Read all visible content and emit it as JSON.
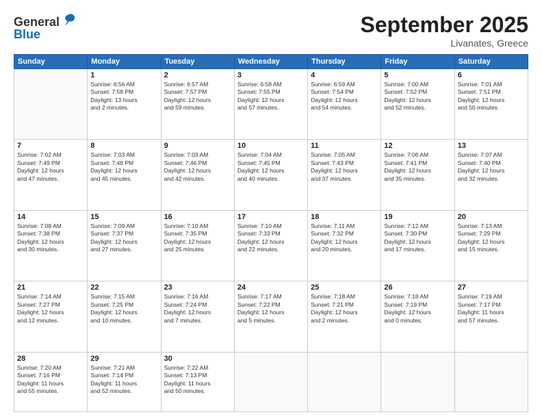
{
  "logo": {
    "general": "General",
    "blue": "Blue"
  },
  "title": "September 2025",
  "location": "Livanates, Greece",
  "days_header": [
    "Sunday",
    "Monday",
    "Tuesday",
    "Wednesday",
    "Thursday",
    "Friday",
    "Saturday"
  ],
  "weeks": [
    [
      {
        "day": "",
        "sunrise": "",
        "sunset": "",
        "daylight": "",
        "empty": true
      },
      {
        "day": "1",
        "sunrise": "Sunrise: 6:56 AM",
        "sunset": "Sunset: 7:58 PM",
        "daylight": "Daylight: 13 hours and 2 minutes."
      },
      {
        "day": "2",
        "sunrise": "Sunrise: 6:57 AM",
        "sunset": "Sunset: 7:57 PM",
        "daylight": "Daylight: 12 hours and 59 minutes."
      },
      {
        "day": "3",
        "sunrise": "Sunrise: 6:58 AM",
        "sunset": "Sunset: 7:55 PM",
        "daylight": "Daylight: 12 hours and 57 minutes."
      },
      {
        "day": "4",
        "sunrise": "Sunrise: 6:59 AM",
        "sunset": "Sunset: 7:54 PM",
        "daylight": "Daylight: 12 hours and 54 minutes."
      },
      {
        "day": "5",
        "sunrise": "Sunrise: 7:00 AM",
        "sunset": "Sunset: 7:52 PM",
        "daylight": "Daylight: 12 hours and 52 minutes."
      },
      {
        "day": "6",
        "sunrise": "Sunrise: 7:01 AM",
        "sunset": "Sunset: 7:51 PM",
        "daylight": "Daylight: 12 hours and 50 minutes."
      }
    ],
    [
      {
        "day": "7",
        "sunrise": "Sunrise: 7:02 AM",
        "sunset": "Sunset: 7:49 PM",
        "daylight": "Daylight: 12 hours and 47 minutes."
      },
      {
        "day": "8",
        "sunrise": "Sunrise: 7:03 AM",
        "sunset": "Sunset: 7:48 PM",
        "daylight": "Daylight: 12 hours and 45 minutes."
      },
      {
        "day": "9",
        "sunrise": "Sunrise: 7:03 AM",
        "sunset": "Sunset: 7:46 PM",
        "daylight": "Daylight: 12 hours and 42 minutes."
      },
      {
        "day": "10",
        "sunrise": "Sunrise: 7:04 AM",
        "sunset": "Sunset: 7:45 PM",
        "daylight": "Daylight: 12 hours and 40 minutes."
      },
      {
        "day": "11",
        "sunrise": "Sunrise: 7:05 AM",
        "sunset": "Sunset: 7:43 PM",
        "daylight": "Daylight: 12 hours and 37 minutes."
      },
      {
        "day": "12",
        "sunrise": "Sunrise: 7:06 AM",
        "sunset": "Sunset: 7:41 PM",
        "daylight": "Daylight: 12 hours and 35 minutes."
      },
      {
        "day": "13",
        "sunrise": "Sunrise: 7:07 AM",
        "sunset": "Sunset: 7:40 PM",
        "daylight": "Daylight: 12 hours and 32 minutes."
      }
    ],
    [
      {
        "day": "14",
        "sunrise": "Sunrise: 7:08 AM",
        "sunset": "Sunset: 7:38 PM",
        "daylight": "Daylight: 12 hours and 30 minutes."
      },
      {
        "day": "15",
        "sunrise": "Sunrise: 7:09 AM",
        "sunset": "Sunset: 7:37 PM",
        "daylight": "Daylight: 12 hours and 27 minutes."
      },
      {
        "day": "16",
        "sunrise": "Sunrise: 7:10 AM",
        "sunset": "Sunset: 7:35 PM",
        "daylight": "Daylight: 12 hours and 25 minutes."
      },
      {
        "day": "17",
        "sunrise": "Sunrise: 7:10 AM",
        "sunset": "Sunset: 7:33 PM",
        "daylight": "Daylight: 12 hours and 22 minutes."
      },
      {
        "day": "18",
        "sunrise": "Sunrise: 7:11 AM",
        "sunset": "Sunset: 7:32 PM",
        "daylight": "Daylight: 12 hours and 20 minutes."
      },
      {
        "day": "19",
        "sunrise": "Sunrise: 7:12 AM",
        "sunset": "Sunset: 7:30 PM",
        "daylight": "Daylight: 12 hours and 17 minutes."
      },
      {
        "day": "20",
        "sunrise": "Sunrise: 7:13 AM",
        "sunset": "Sunset: 7:29 PM",
        "daylight": "Daylight: 12 hours and 15 minutes."
      }
    ],
    [
      {
        "day": "21",
        "sunrise": "Sunrise: 7:14 AM",
        "sunset": "Sunset: 7:27 PM",
        "daylight": "Daylight: 12 hours and 12 minutes."
      },
      {
        "day": "22",
        "sunrise": "Sunrise: 7:15 AM",
        "sunset": "Sunset: 7:25 PM",
        "daylight": "Daylight: 12 hours and 10 minutes."
      },
      {
        "day": "23",
        "sunrise": "Sunrise: 7:16 AM",
        "sunset": "Sunset: 7:24 PM",
        "daylight": "Daylight: 12 hours and 7 minutes."
      },
      {
        "day": "24",
        "sunrise": "Sunrise: 7:17 AM",
        "sunset": "Sunset: 7:22 PM",
        "daylight": "Daylight: 12 hours and 5 minutes."
      },
      {
        "day": "25",
        "sunrise": "Sunrise: 7:18 AM",
        "sunset": "Sunset: 7:21 PM",
        "daylight": "Daylight: 12 hours and 2 minutes."
      },
      {
        "day": "26",
        "sunrise": "Sunrise: 7:18 AM",
        "sunset": "Sunset: 7:19 PM",
        "daylight": "Daylight: 12 hours and 0 minutes."
      },
      {
        "day": "27",
        "sunrise": "Sunrise: 7:19 AM",
        "sunset": "Sunset: 7:17 PM",
        "daylight": "Daylight: 11 hours and 57 minutes."
      }
    ],
    [
      {
        "day": "28",
        "sunrise": "Sunrise: 7:20 AM",
        "sunset": "Sunset: 7:16 PM",
        "daylight": "Daylight: 11 hours and 55 minutes."
      },
      {
        "day": "29",
        "sunrise": "Sunrise: 7:21 AM",
        "sunset": "Sunset: 7:14 PM",
        "daylight": "Daylight: 11 hours and 52 minutes."
      },
      {
        "day": "30",
        "sunrise": "Sunrise: 7:22 AM",
        "sunset": "Sunset: 7:13 PM",
        "daylight": "Daylight: 11 hours and 50 minutes."
      },
      {
        "day": "",
        "sunrise": "",
        "sunset": "",
        "daylight": "",
        "empty": true
      },
      {
        "day": "",
        "sunrise": "",
        "sunset": "",
        "daylight": "",
        "empty": true
      },
      {
        "day": "",
        "sunrise": "",
        "sunset": "",
        "daylight": "",
        "empty": true
      },
      {
        "day": "",
        "sunrise": "",
        "sunset": "",
        "daylight": "",
        "empty": true
      }
    ]
  ]
}
